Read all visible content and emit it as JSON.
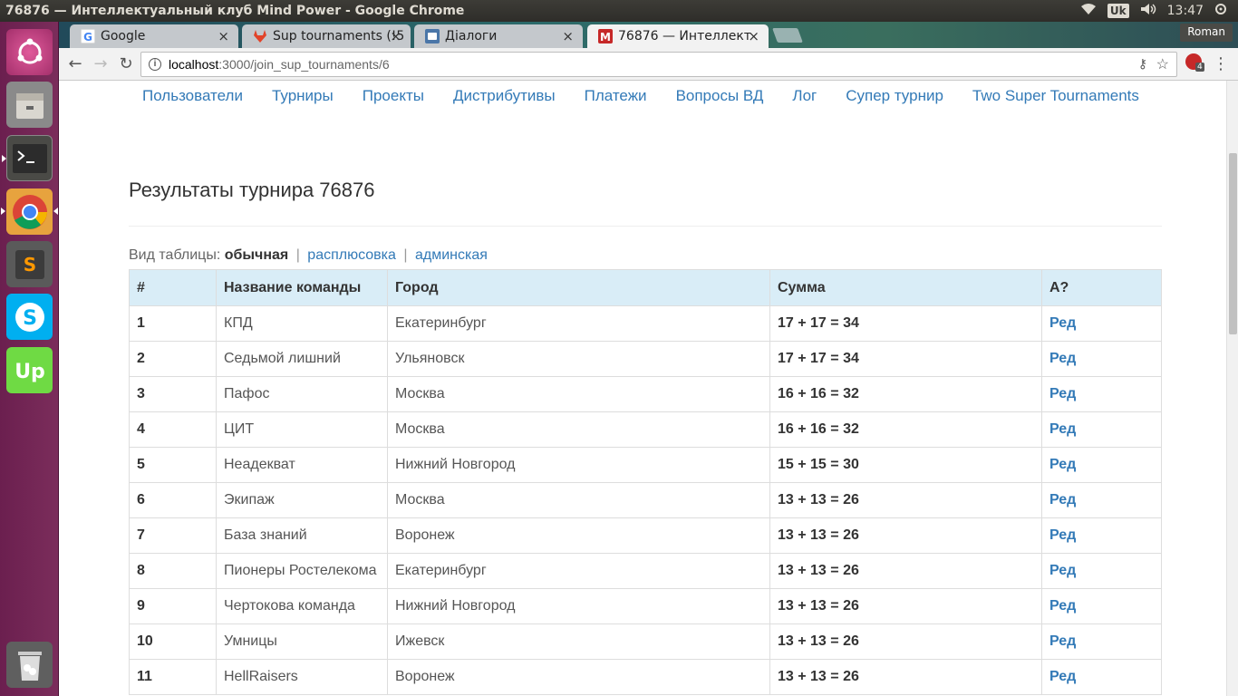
{
  "system": {
    "window_title": "76876 — Интеллектуальный клуб Mind Power - Google Chrome",
    "keyboard_layout": "Uk",
    "clock": "13:47"
  },
  "browser": {
    "tabs": [
      {
        "title": "Google",
        "favicon_color": "#4285f4"
      },
      {
        "title": "Sup tournaments (!5",
        "favicon_color": "#e24329"
      },
      {
        "title": "Діалоги",
        "favicon_color": "#4a76a8"
      },
      {
        "title": "76876 — Интеллект",
        "favicon_color": "#c62828"
      }
    ],
    "profile_name": "Roman",
    "url_host": "localhost",
    "url_path": ":3000/join_sup_tournaments/6",
    "ext_badge": "4"
  },
  "page": {
    "nav": [
      "Пользователи",
      "Турниры",
      "Проекты",
      "Дистрибутивы",
      "Платежи",
      "Вопросы ВД",
      "Лог",
      "Супер турнир",
      "Two Super Tournaments"
    ],
    "title": "Результаты турнира 76876",
    "view_label": "Вид таблицы:",
    "view_current": "обычная",
    "view_links": [
      "расплюсовка",
      "админская"
    ],
    "table_headers": [
      "#",
      "Название команды",
      "Город",
      "Сумма",
      "А?"
    ],
    "rows": [
      {
        "n": "1",
        "team": "КПД",
        "city": "Екатеринбург",
        "sum": "17 + 17 = 34",
        "action": "Ред"
      },
      {
        "n": "2",
        "team": "Седьмой лишний",
        "city": "Ульяновск",
        "sum": "17 + 17 = 34",
        "action": "Ред"
      },
      {
        "n": "3",
        "team": "Пафос",
        "city": "Москва",
        "sum": "16 + 16 = 32",
        "action": "Ред"
      },
      {
        "n": "4",
        "team": "ЦИТ",
        "city": "Москва",
        "sum": "16 + 16 = 32",
        "action": "Ред"
      },
      {
        "n": "5",
        "team": "Неадекват",
        "city": "Нижний Новгород",
        "sum": "15 + 15 = 30",
        "action": "Ред"
      },
      {
        "n": "6",
        "team": "Экипаж",
        "city": "Москва",
        "sum": "13 + 13 = 26",
        "action": "Ред"
      },
      {
        "n": "7",
        "team": "База знаний",
        "city": "Воронеж",
        "sum": "13 + 13 = 26",
        "action": "Ред"
      },
      {
        "n": "8",
        "team": "Пионеры Ростелекома",
        "city": "Екатеринбург",
        "sum": "13 + 13 = 26",
        "action": "Ред"
      },
      {
        "n": "9",
        "team": "Чертокова команда",
        "city": "Нижний Новгород",
        "sum": "13 + 13 = 26",
        "action": "Ред"
      },
      {
        "n": "10",
        "team": "Умницы",
        "city": "Ижевск",
        "sum": "13 + 13 = 26",
        "action": "Ред"
      },
      {
        "n": "11",
        "team": "HellRaisers",
        "city": "Воронеж",
        "sum": "13 + 13 = 26",
        "action": "Ред"
      }
    ]
  },
  "launcher": [
    "ubuntu-icon",
    "files-icon",
    "terminal-icon",
    "chrome-icon",
    "sublime-icon",
    "skype-icon",
    "upwork-icon",
    "trash-icon"
  ]
}
